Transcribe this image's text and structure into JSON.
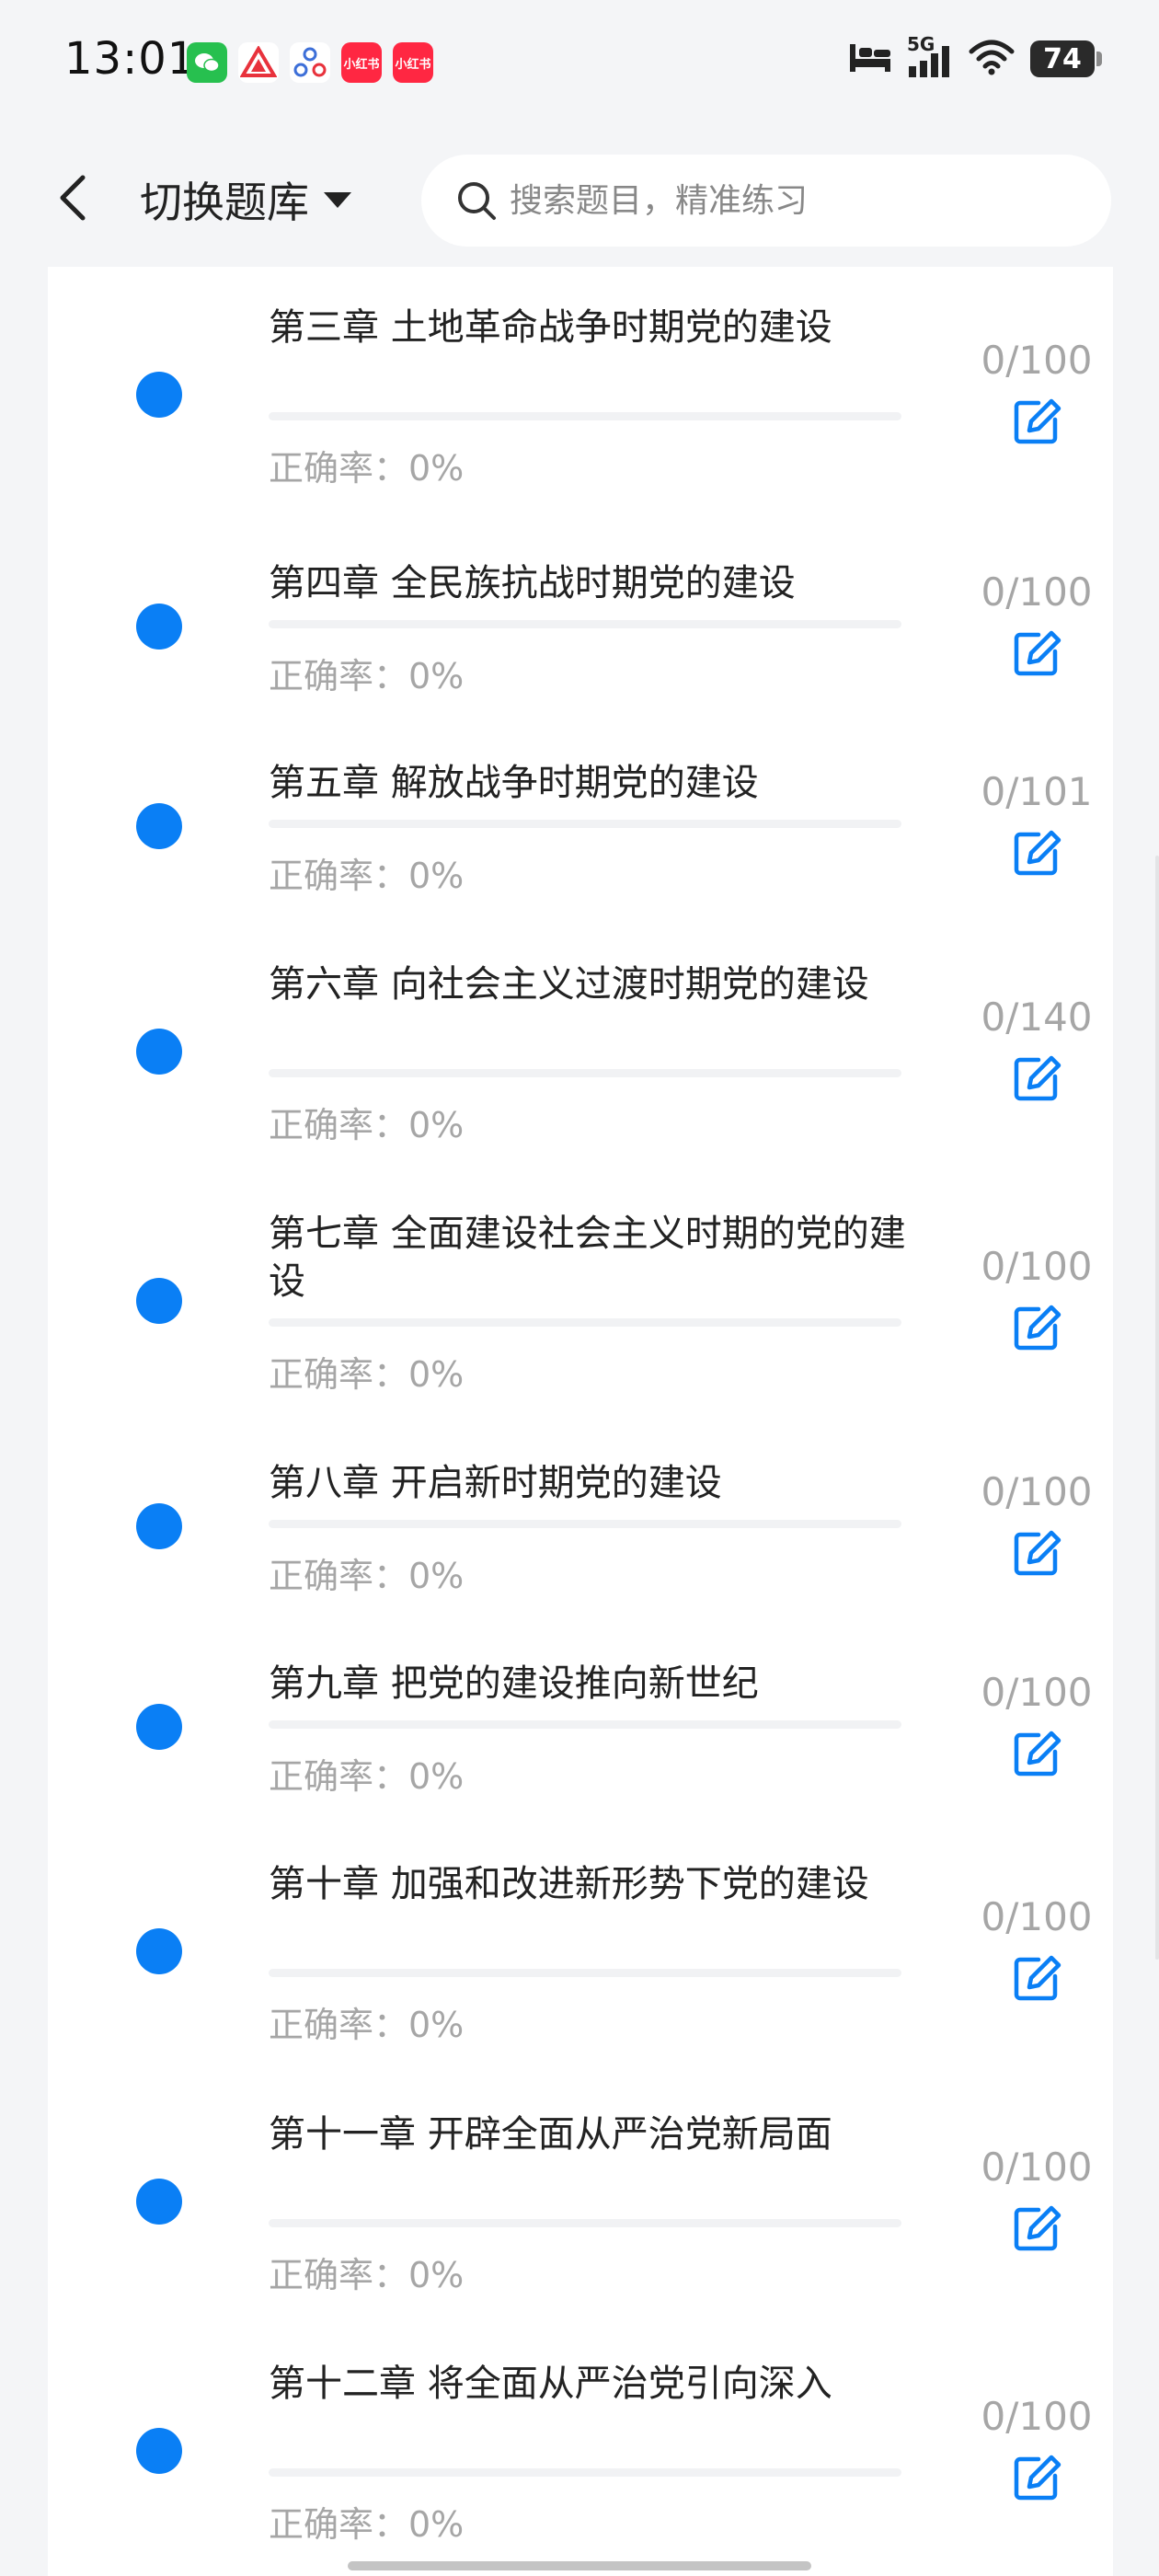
{
  "status_bar": {
    "time": "13:01",
    "network": "5G",
    "battery": "74",
    "app_icons": [
      "wechat-icon",
      "triangle-app-icon",
      "nodes-app-icon",
      "xiaohongshu-icon",
      "xiaohongshu-icon"
    ],
    "xhs_label": "小红书"
  },
  "header": {
    "bank_switch_label": "切换题库",
    "search_placeholder": "搜索题目，精准练习"
  },
  "colors": {
    "accent": "#0a7ff5",
    "muted_text": "#a6a6a6",
    "progress_track": "#f1f2f4"
  },
  "chapters": [
    {
      "title": "第三章 土地革命战争时期党的建设",
      "accuracy_label": "正确率：0%",
      "count": "0/100",
      "progress": 0
    },
    {
      "title": "第四章 全民族抗战时期党的建设",
      "accuracy_label": "正确率：0%",
      "count": "0/100",
      "progress": 0
    },
    {
      "title": "第五章 解放战争时期党的建设",
      "accuracy_label": "正确率：0%",
      "count": "0/101",
      "progress": 0
    },
    {
      "title": "第六章 向社会主义过渡时期党的建设",
      "accuracy_label": "正确率：0%",
      "count": "0/140",
      "progress": 0
    },
    {
      "title": "第七章 全面建设社会主义时期的党的建设",
      "accuracy_label": "正确率：0%",
      "count": "0/100",
      "progress": 0
    },
    {
      "title": "第八章 开启新时期党的建设",
      "accuracy_label": "正确率：0%",
      "count": "0/100",
      "progress": 0
    },
    {
      "title": "第九章 把党的建设推向新世纪",
      "accuracy_label": "正确率：0%",
      "count": "0/100",
      "progress": 0
    },
    {
      "title": "第十章 加强和改进新形势下党的建设",
      "accuracy_label": "正确率：0%",
      "count": "0/100",
      "progress": 0
    },
    {
      "title": "第十一章 开辟全面从严治党新局面",
      "accuracy_label": "正确率：0%",
      "count": "0/100",
      "progress": 0
    },
    {
      "title": "第十二章 将全面从严治党引向深入",
      "accuracy_label": "正确率：0%",
      "count": "0/100",
      "progress": 0
    }
  ]
}
